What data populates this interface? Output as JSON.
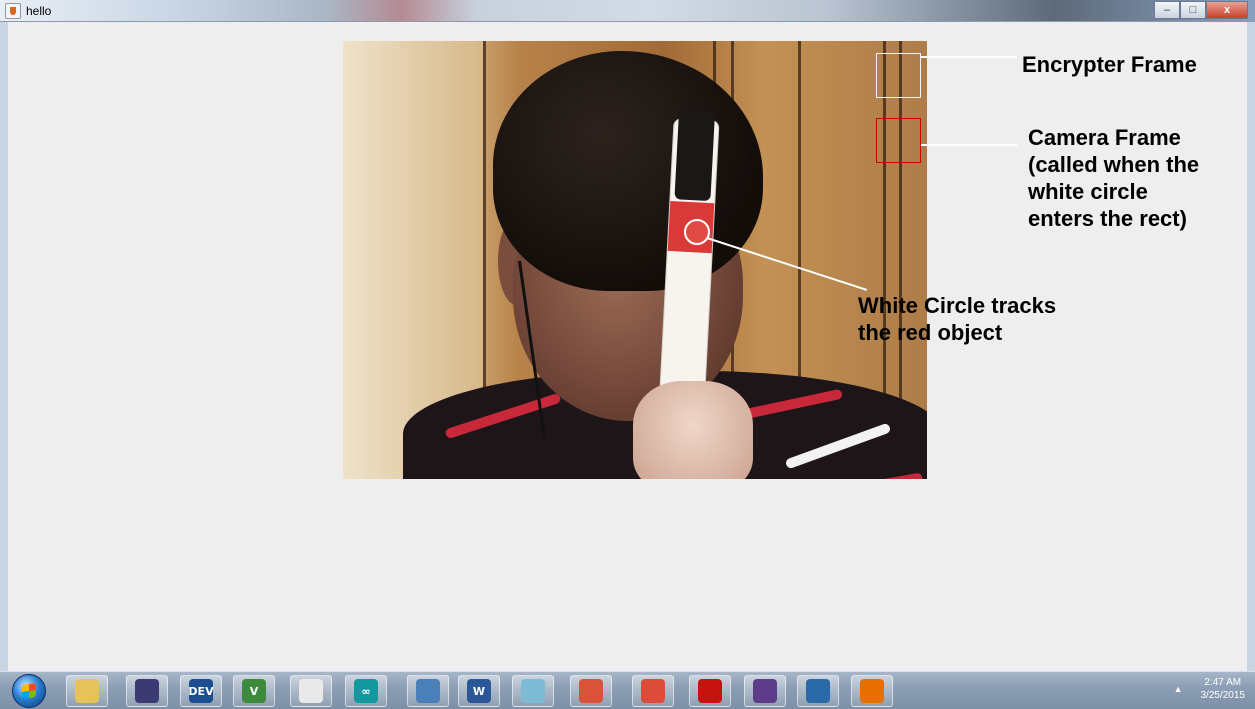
{
  "window": {
    "title": "hello",
    "controls": {
      "minimize": "–",
      "maximize": "□",
      "close": "x"
    }
  },
  "annotations": {
    "encrypter_frame": "Encrypter Frame",
    "camera_frame": [
      "Camera Frame",
      "(called when the",
      "white circle",
      "enters the rect)"
    ],
    "white_circle": [
      "White Circle tracks",
      "the red object"
    ]
  },
  "taskbar": {
    "apps": [
      {
        "name": "windows-explorer-icon",
        "color": "#e6c35a",
        "glyph": ""
      },
      {
        "name": "eclipse-icon",
        "color": "#3b3a73",
        "glyph": ""
      },
      {
        "name": "devcpp-icon",
        "color": "#1d4e8f",
        "glyph": "DEV"
      },
      {
        "name": "vs-icon",
        "color": "#3e8a3d",
        "glyph": "V"
      },
      {
        "name": "plotter-icon",
        "color": "#e9e9e9",
        "glyph": ""
      },
      {
        "name": "arduino-icon",
        "color": "#11999e",
        "glyph": "∞"
      },
      {
        "name": "python-icon",
        "color": "#4b7fb8",
        "glyph": ""
      },
      {
        "name": "word-icon",
        "color": "#2b5797",
        "glyph": "W"
      },
      {
        "name": "glass-icon",
        "color": "#7dbad6",
        "glyph": ""
      },
      {
        "name": "paint-icon",
        "color": "#d8533a",
        "glyph": ""
      },
      {
        "name": "chrome-icon",
        "color": "#dd4b39",
        "glyph": ""
      },
      {
        "name": "acrobat-icon",
        "color": "#c7130f",
        "glyph": ""
      },
      {
        "name": "cat-icon",
        "color": "#5d3d8a",
        "glyph": ""
      },
      {
        "name": "virtualbox-icon",
        "color": "#2b6aa8",
        "glyph": ""
      },
      {
        "name": "java-icon",
        "color": "#e76f00",
        "glyph": ""
      }
    ],
    "clock": {
      "time": "2:47 AM",
      "date": "3/25/2015"
    },
    "tray_chevron": "▲"
  }
}
